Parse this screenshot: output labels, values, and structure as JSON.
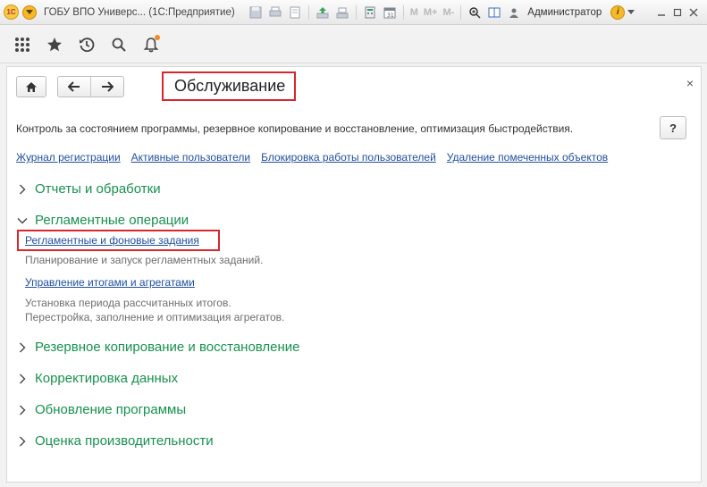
{
  "titlebar": {
    "logo_text": "1С",
    "app_title": "ГОБУ ВПО Универс...  (1С:Предприятие)",
    "m_labels": [
      "M",
      "M+",
      "M-"
    ],
    "user": "Администратор",
    "info_glyph": "i",
    "icons": [
      "save-icon",
      "print-icon",
      "preview-icon",
      "upload-icon",
      "download-icon",
      "calculator-icon",
      "calendar-icon",
      "zoom-icon",
      "panel-icon"
    ]
  },
  "navbar": {
    "icons": [
      "apps-grid-icon",
      "star-icon",
      "history-icon",
      "search-icon",
      "bell-icon"
    ],
    "bell_badge_color": "#f08a24"
  },
  "page": {
    "title": "Обслуживание",
    "close_glyph": "×",
    "description": "Контроль за состоянием программы, резервное копирование и восстановление, оптимизация быстродействия.",
    "help_label": "?",
    "links": [
      "Журнал регистрации",
      "Активные пользователи",
      "Блокировка работы пользователей",
      "Удаление помеченных объектов"
    ],
    "sections": {
      "reports": "Отчеты и обработки",
      "routine": "Регламентные операции",
      "backup": "Резервное копирование и восстановление",
      "correction": "Корректировка данных",
      "update": "Обновление программы",
      "performance": "Оценка производительности"
    },
    "routine_items": {
      "jobs_link": "Регламентные и фоновые задания",
      "jobs_desc": "Планирование и запуск регламентных заданий.",
      "totals_link": "Управление итогами и агрегатами",
      "totals_desc_1": "Установка периода рассчитанных итогов.",
      "totals_desc_2": "Перестройка, заполнение и оптимизация агрегатов."
    }
  },
  "colors": {
    "section_green": "#17914e",
    "link_blue": "#1f4f9e",
    "highlight_red": "#d9262c",
    "accent_orange": "#f5b829"
  }
}
